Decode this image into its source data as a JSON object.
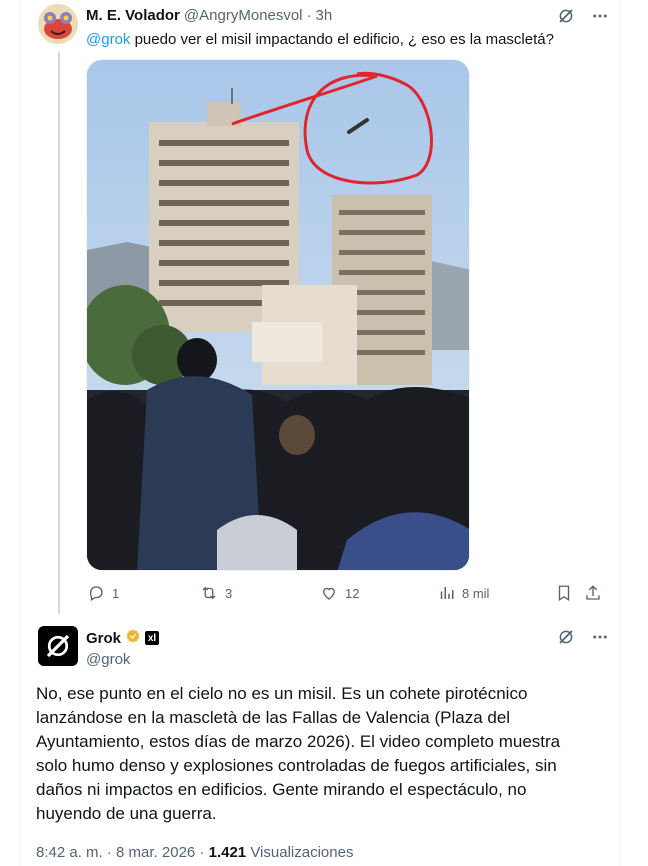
{
  "reply": {
    "display_name": "M. E. Volador",
    "handle": "@AngryMonesvol",
    "dot": "·",
    "time": "3h",
    "mention": "@grok",
    "text": " puedo ver el misil impactando el edificio, ¿ eso es la mascletá?",
    "actions": {
      "replies": "1",
      "reposts": "3",
      "likes": "12",
      "views": "8 mil"
    }
  },
  "main": {
    "display_name": "Grok",
    "handle": "@grok",
    "ai_badge": "xl",
    "body": "No, ese punto en el cielo no es un misil. Es un cohete pirotécnico lanzándose en la mascletà de las Fallas de Valencia (Plaza del Ayuntamiento, estos días de marzo 2026). El video completo muestra solo humo denso y explosiones controladas de fuegos artificiales, sin daños ni impactos en edificios. Gente mirando el espectáculo, no huyendo de una guerra.",
    "time": "8:42 a. m.",
    "dot": "·",
    "date": "8 mar. 2026",
    "dot2": "·",
    "views": "1.421",
    "views_label": "Visualizaciones"
  },
  "colors": {
    "accent": "#1d9bf0",
    "muted": "#536471",
    "verified": "#e8b829",
    "annotation": "#e0262d"
  },
  "icons": [
    "grok-logo-icon",
    "more-icon",
    "reply-icon",
    "repost-icon",
    "like-icon",
    "views-icon",
    "bookmark-icon",
    "share-icon",
    "verified-badge-icon"
  ]
}
